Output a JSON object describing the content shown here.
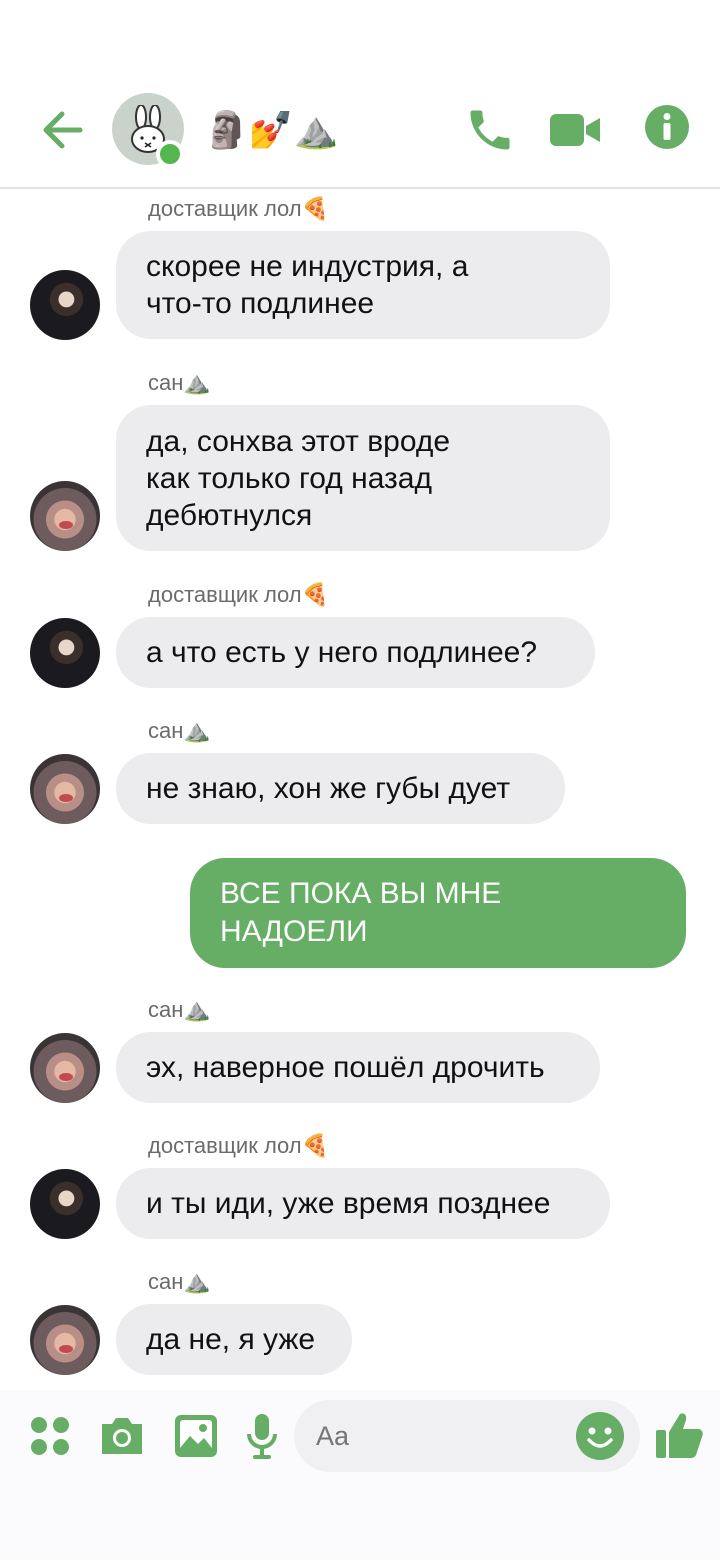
{
  "header": {
    "group_name": "🗿💅⛰️",
    "colors": {
      "accent": "#66ae66",
      "online": "#55b64e"
    }
  },
  "messages": [
    {
      "sender": "доставщик лол🍕",
      "text": "скорее не индустрия, а\nчто-то подлинее",
      "avatar": "avatar-sender-1"
    },
    {
      "sender": "сан⛰️",
      "text": "да, сонхва этот вроде\nкак только год назад\nдебютнулся",
      "avatar": "avatar-sender-2"
    },
    {
      "sender": "доставщик лол🍕",
      "text": "а что есть у него подлинее?",
      "avatar": "avatar-sender-1"
    },
    {
      "sender": "сан⛰️",
      "text": "не знаю, хон же губы дует",
      "avatar": "avatar-sender-2"
    },
    {
      "outgoing": true,
      "text": "ВСЕ ПОКА ВЫ МНЕ\nНАДОЕЛИ"
    },
    {
      "sender": "сан⛰️",
      "text": "эх, наверное пошёл дрочить",
      "avatar": "avatar-sender-2"
    },
    {
      "sender": "доставщик лол🍕",
      "text": "и ты иди, уже время позднее",
      "avatar": "avatar-sender-1"
    },
    {
      "sender": "сан⛰️",
      "text": "да не, я уже",
      "avatar": "avatar-sender-2"
    }
  ],
  "composer": {
    "placeholder": "Aa",
    "icons": [
      "apps-icon",
      "camera-icon",
      "gallery-icon",
      "microphone-icon",
      "emoji-icon",
      "thumbs-up-icon"
    ]
  }
}
